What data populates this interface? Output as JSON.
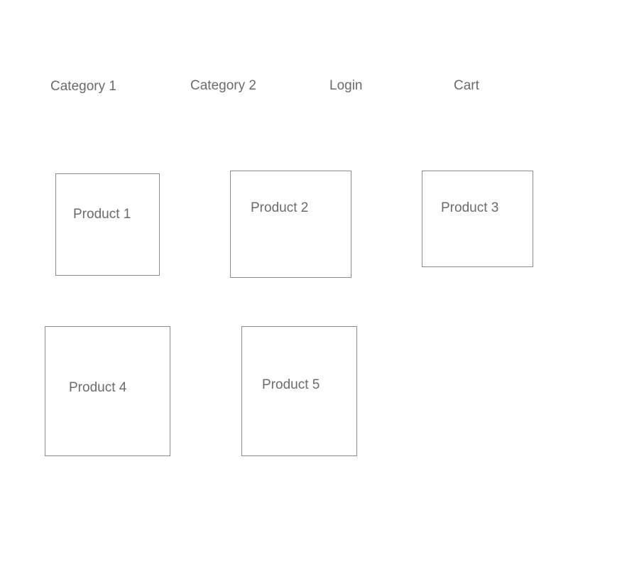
{
  "nav": {
    "category_1": "Category 1",
    "category_2": "Category 2",
    "login": "Login",
    "cart": "Cart"
  },
  "products": [
    {
      "label": "Product 1"
    },
    {
      "label": "Product 2"
    },
    {
      "label": "Product 3"
    },
    {
      "label": "Product 4"
    },
    {
      "label": "Product 5"
    }
  ],
  "colors": {
    "text": "#6b6b6b",
    "border": "#8a8a8a",
    "background": "#ffffff"
  }
}
